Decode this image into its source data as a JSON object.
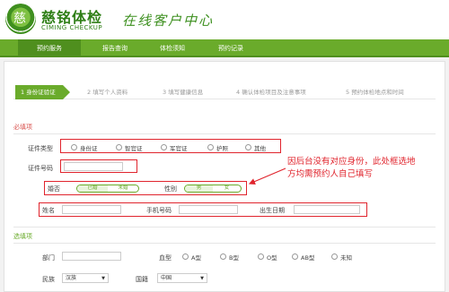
{
  "header": {
    "brand_name": "慈铭体检",
    "brand_english": "CIMING CHECKUP",
    "slogan": "在线客户中心",
    "logo_glyph": "慈"
  },
  "nav": {
    "items": [
      "预约服务",
      "报告查询",
      "体检须知",
      "预约记录"
    ],
    "active_index": 0
  },
  "steps": [
    "1 身份证验证",
    "2 填写个人资料",
    "3 填写健康信息",
    "4 确认体检项目及注意事项",
    "5 预约体检地点和时间"
  ],
  "required_section": {
    "title": "必填项",
    "id_type_label": "证件类型",
    "id_type_options": [
      "身份证",
      "智官证",
      "军官证",
      "护照",
      "其他"
    ],
    "id_number_label": "证件号码",
    "marital_label": "婚否",
    "marital_options": [
      "已婚",
      "未婚"
    ],
    "gender_label": "性别",
    "gender_options": [
      "男",
      "女"
    ],
    "name_label": "姓名",
    "phone_label": "手机号码",
    "birth_label": "出生日期"
  },
  "annotation": {
    "line1": "因后台没有对应身份，此处框选地",
    "line2": "方均需预约人自己填写"
  },
  "optional_section": {
    "title": "选填项",
    "dept_label": "部门",
    "blood_label": "血型",
    "blood_options": [
      "A型",
      "B型",
      "O型",
      "AB型",
      "未知"
    ],
    "ethnicity_label": "民族",
    "ethnicity_value": "汉族",
    "nationality_label": "国籍",
    "nationality_value": "中国"
  },
  "colors": {
    "brand_green": "#6aab2b",
    "annotation_red": "#e0242d",
    "required_red": "#d9534f"
  }
}
